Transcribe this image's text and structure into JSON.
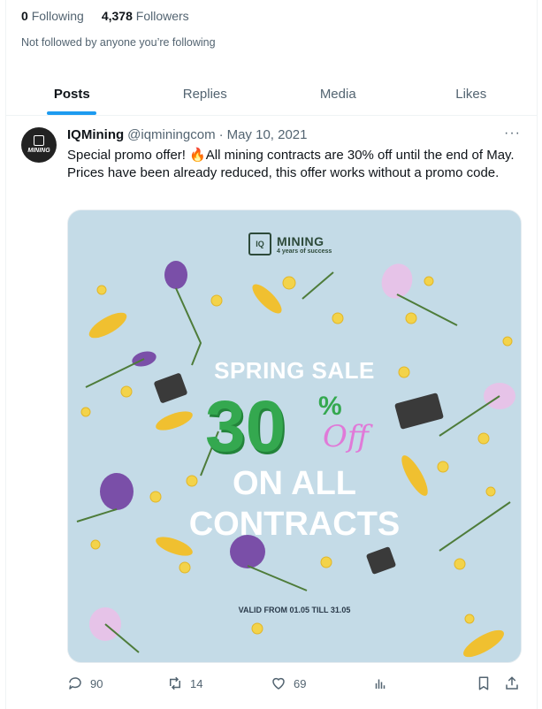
{
  "profile": {
    "following_count": "0",
    "following_label": "Following",
    "followers_count": "4,378",
    "followers_label": "Followers",
    "followed_note": "Not followed by anyone you’re following"
  },
  "tabs": [
    {
      "label": "Posts",
      "active": true
    },
    {
      "label": "Replies",
      "active": false
    },
    {
      "label": "Media",
      "active": false
    },
    {
      "label": "Likes",
      "active": false
    }
  ],
  "post": {
    "author": "IQMining",
    "handle": "@iqminingcom",
    "separator": "·",
    "date": "May 10, 2021",
    "more_label": "···",
    "avatar_text": "MINING",
    "text": "Special promo offer! 🔥All mining contracts are 30% off until the end of May. Prices have been already reduced, this offer works without a promo code.",
    "image": {
      "brand_chip": "IQ",
      "brand_name": "MINING",
      "brand_tagline": "4 years of success",
      "line1": "SPRING SALE",
      "big_number": "30",
      "percent": "%",
      "off": "Off",
      "line2": "ON ALL",
      "line3": "CONTRACTS",
      "valid": "VALID FROM 01.05 TILL 31.05"
    },
    "actions": {
      "replies": "90",
      "reposts": "14",
      "likes": "69"
    }
  },
  "colors": {
    "accent": "#1d9bf0",
    "green": "#34a84f",
    "pink": "#e07ad8",
    "image_bg": "#c6dce8"
  }
}
